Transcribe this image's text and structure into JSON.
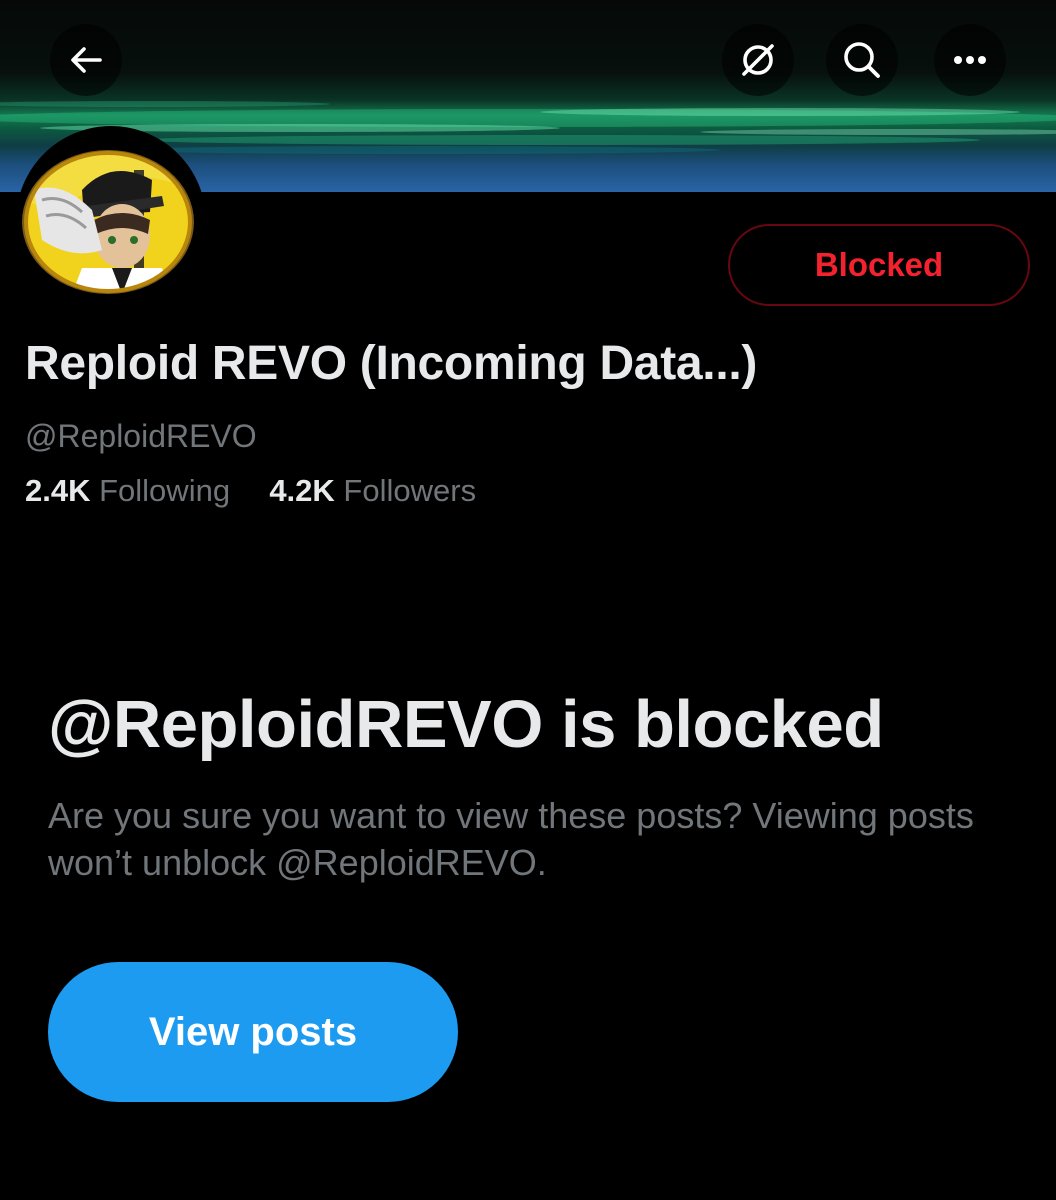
{
  "header": {
    "back_icon": "arrow-left-icon",
    "grok_icon": "grok-icon",
    "search_icon": "search-icon",
    "more_icon": "more-horizontal-icon"
  },
  "profile": {
    "display_name": "Reploid REVO (Incoming Data...)",
    "handle": "@ReploidREVO",
    "following_count": "2.4K",
    "following_label": "Following",
    "followers_count": "4.2K",
    "followers_label": "Followers",
    "blocked_button_label": "Blocked"
  },
  "blocked_notice": {
    "title": "@ReploidREVO is blocked",
    "description": "Are you sure you want to view these posts? Viewing posts won’t unblock @ReploidREVO.",
    "view_button_label": "View posts"
  },
  "colors": {
    "background": "#000000",
    "primary_text": "#e7e9ea",
    "secondary_text": "#71767b",
    "blocked_red": "#f4212e",
    "blocked_border": "#67070f",
    "accent_blue": "#1d9bf0"
  }
}
